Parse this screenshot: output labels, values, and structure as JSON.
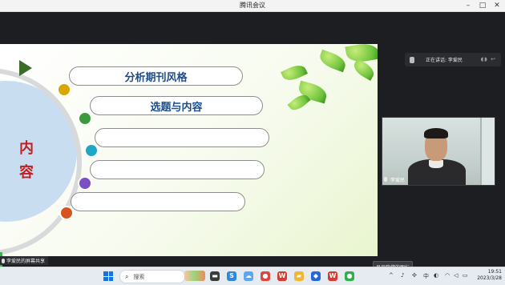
{
  "window": {
    "title": "腾讯会议",
    "minimize": "–",
    "maximize": "□",
    "close": "✕"
  },
  "slide": {
    "content_chars": [
      "内",
      "容"
    ],
    "items": [
      {
        "label": "分析期刊风格",
        "bullet_color": "#d9a800"
      },
      {
        "label": "选题与内容",
        "bullet_color": "#3c9a3c"
      },
      {
        "label": "",
        "bullet_color": "#21a6c6"
      },
      {
        "label": "",
        "bullet_color": "#7b4fc4"
      },
      {
        "label": "",
        "bullet_color": "#d8541f"
      }
    ]
  },
  "speaking": {
    "text": "正在讲话: 李爱民",
    "icons": "◖◗ ↩"
  },
  "video": {
    "participant_name": "李爱民"
  },
  "tooltip": {
    "text": "显示隐藏的图标"
  },
  "sharer": {
    "text": "李爱民的屏幕共享"
  },
  "taskbar": {
    "search_placeholder": "搜索",
    "search_icon": "⌕",
    "apps": [
      {
        "name": "file-explorer-icon",
        "glyph": "▬",
        "color": "#3b3b3b"
      },
      {
        "name": "app-s-icon",
        "glyph": "S",
        "color": "#2d88e0"
      },
      {
        "name": "app-cloud-icon",
        "glyph": "☁",
        "color": "#5aa9f0"
      },
      {
        "name": "chrome-icon",
        "glyph": "●",
        "color": "#e0453b"
      },
      {
        "name": "wps-icon",
        "glyph": "W",
        "color": "#d93a2f"
      },
      {
        "name": "folder-icon",
        "glyph": "▰",
        "color": "#f2b636"
      },
      {
        "name": "tencent-meeting-icon",
        "glyph": "◆",
        "color": "#2468d8"
      },
      {
        "name": "wps-2-icon",
        "glyph": "W",
        "color": "#d93a2f"
      },
      {
        "name": "wechat-icon",
        "glyph": "●",
        "color": "#2fb14a"
      }
    ],
    "tray_chevron": "^",
    "clock_time": "19:51",
    "clock_date": "2023/3/28"
  }
}
